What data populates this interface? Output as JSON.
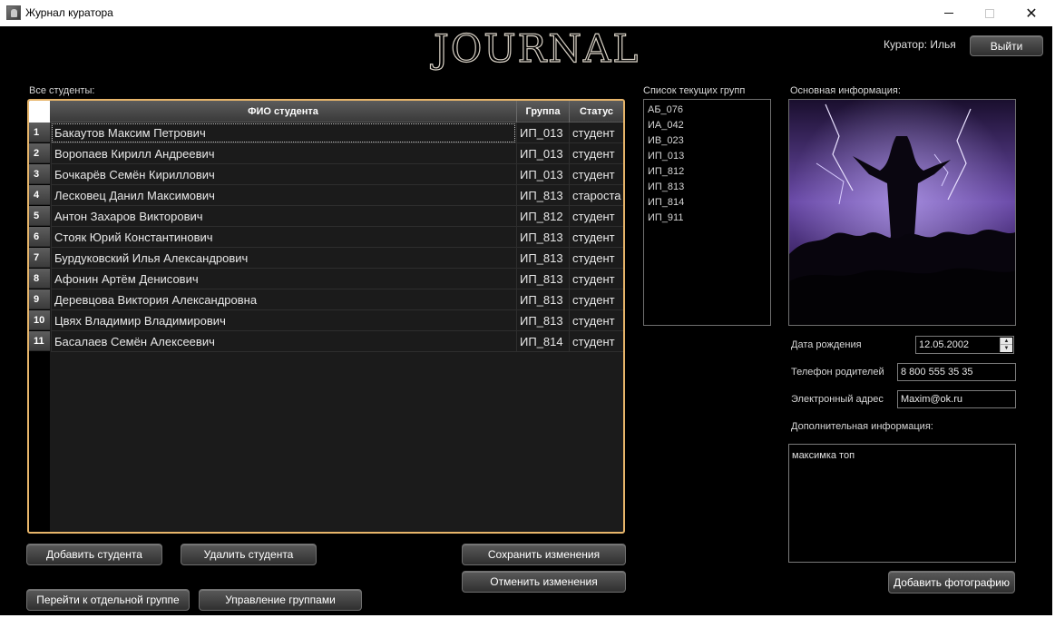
{
  "window": {
    "title": "Журнал куратора",
    "minimize_icon": "minimize-icon",
    "maximize_icon": "maximize-icon",
    "close_icon": "close-icon",
    "close_glyph": "✕"
  },
  "header": {
    "logo": "JOURNAL",
    "curator": "Куратор: Илья",
    "logout_label": "Выйти"
  },
  "students": {
    "label": "Все студенты:",
    "columns": {
      "name": "ФИО студента",
      "group": "Группа",
      "status": "Статус"
    },
    "rows": [
      {
        "num": "1",
        "name": "Бакаутов Максим Петрович",
        "group": "ИП_013",
        "status": "студент"
      },
      {
        "num": "2",
        "name": "Воропаев Кирилл Андреевич",
        "group": "ИП_013",
        "status": "студент"
      },
      {
        "num": "3",
        "name": "Бочкарёв Семён Кириллович",
        "group": "ИП_013",
        "status": "студент"
      },
      {
        "num": "4",
        "name": "Лесковец Данил Максимович",
        "group": "ИП_813",
        "status": "староста"
      },
      {
        "num": "5",
        "name": "Антон Захаров Викторович",
        "group": "ИП_812",
        "status": "студент"
      },
      {
        "num": "6",
        "name": "Стояк Юрий Константинович",
        "group": "ИП_813",
        "status": "студент"
      },
      {
        "num": "7",
        "name": "Бурдуковский Илья Александрович",
        "group": "ИП_813",
        "status": "студент"
      },
      {
        "num": "8",
        "name": "Афонин Артём Денисович",
        "group": "ИП_813",
        "status": "студент"
      },
      {
        "num": "9",
        "name": "Деревцова Виктория Александровна",
        "group": "ИП_813",
        "status": "студент"
      },
      {
        "num": "10",
        "name": "Цвях Владимир Владимирович",
        "group": "ИП_813",
        "status": "студент"
      },
      {
        "num": "11",
        "name": "Басалаев Семён Алексеевич",
        "group": "ИП_814",
        "status": "студент"
      }
    ]
  },
  "groups": {
    "label": "Список текущих групп",
    "items": [
      "АБ_076",
      "ИА_042",
      "ИВ_023",
      "ИП_013",
      "ИП_812",
      "ИП_813",
      "ИП_814",
      "ИП_911"
    ]
  },
  "info": {
    "label": "Основная информация:",
    "birth_label": "Дата рождения",
    "birth_value": "12.05.2002",
    "phone_label": "Телефон родителей",
    "phone_value": "8 800 555 35 35",
    "email_label": "Электронный адрес",
    "email_value": "Maxim@ok.ru",
    "extra_label": "Дополнительная информация:",
    "extra_value": "максимка топ",
    "add_photo_label": "Добавить фотографию"
  },
  "actions": {
    "add_student": "Добавить студента",
    "delete_student": "Удалить студента",
    "save_changes": "Сохранить изменения",
    "cancel_changes": "Отменить изменения",
    "goto_group": "Перейти к отдельной группе",
    "manage_groups": "Управление группами"
  }
}
